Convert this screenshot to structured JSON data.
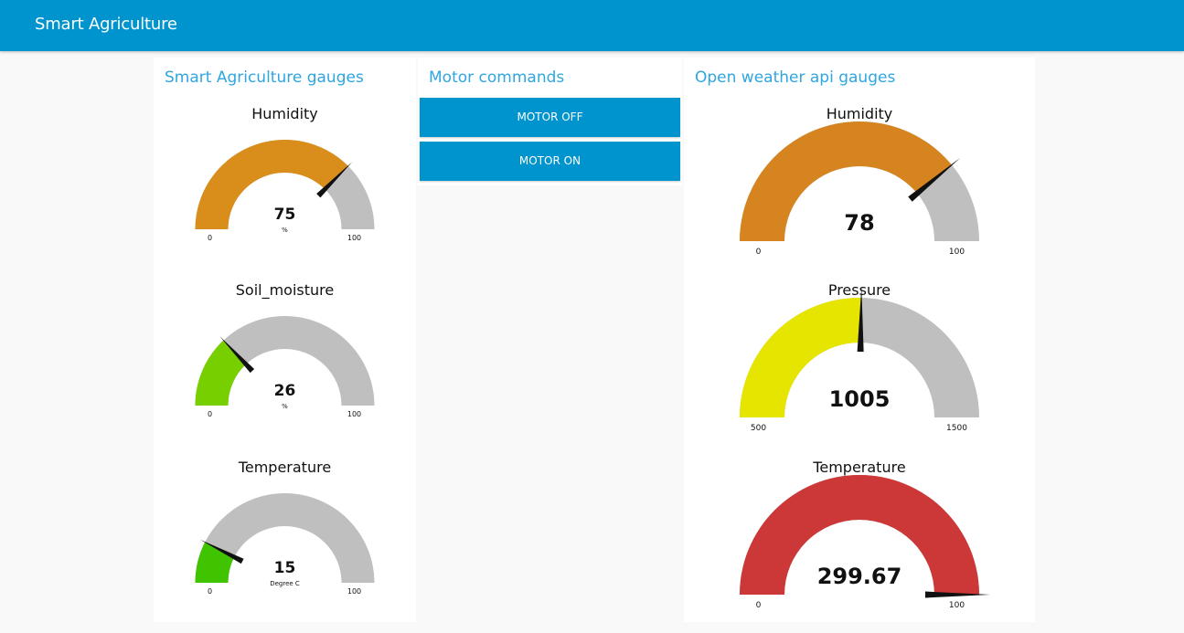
{
  "header": {
    "title": "Smart Agriculture"
  },
  "groups": [
    {
      "title": "Smart Agriculture gauges",
      "gauges": [
        {
          "title": "Humidity",
          "value": "75",
          "unit": "%",
          "min": "0",
          "max": "100",
          "color": "#d98e1c"
        },
        {
          "title": "Soil_moisture",
          "value": "26",
          "unit": "%",
          "min": "0",
          "max": "100",
          "color": "#77cf00"
        },
        {
          "title": "Temperature",
          "value": "15",
          "unit": "Degree C",
          "min": "0",
          "max": "100",
          "color": "#40c400"
        }
      ]
    },
    {
      "title": "Motor commands",
      "buttons": [
        {
          "label": "MOTOR OFF"
        },
        {
          "label": "MOTOR ON"
        }
      ]
    },
    {
      "title": "Open weather api gauges",
      "gauges": [
        {
          "title": "Humidity",
          "value": "78",
          "unit": "",
          "min": "0",
          "max": "100",
          "color": "#d6841f"
        },
        {
          "title": "Pressure",
          "value": "1005",
          "unit": "",
          "min": "500",
          "max": "1500",
          "color": "#e5e500"
        },
        {
          "title": "Temperature",
          "value": "299.67",
          "unit": "",
          "min": "0",
          "max": "100",
          "color": "#cc3838"
        }
      ]
    }
  ],
  "theme": {
    "header_color": "#0094ce",
    "button_color": "#0094ce",
    "title_color": "#2fa6e0",
    "track_color": "#bfbfbf"
  }
}
